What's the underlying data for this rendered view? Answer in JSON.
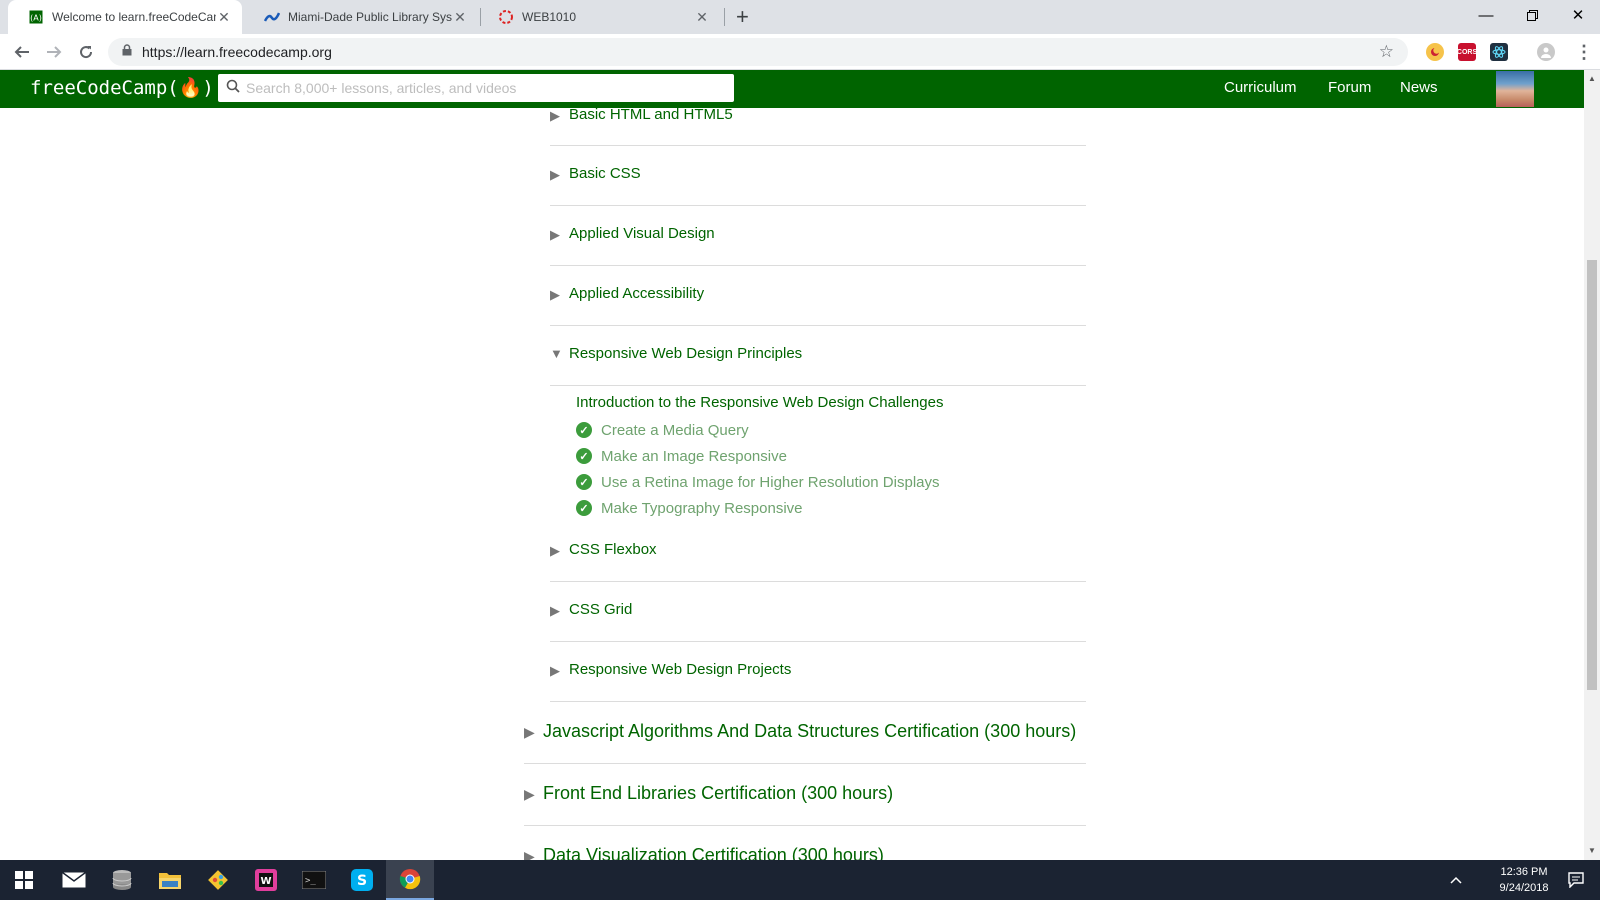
{
  "browser": {
    "tabs": [
      {
        "title": "Welcome to learn.freeCodeCamp"
      },
      {
        "title": "Miami-Dade Public Library Syste"
      },
      {
        "title": "WEB1010"
      }
    ],
    "new_tab_label": "+",
    "url": "https://learn.freecodecamp.org",
    "extensions": [
      "night-icon",
      "cors-icon",
      "react-devtools-icon"
    ]
  },
  "fcc": {
    "logo": "freeCodeCamp(🔥)",
    "search_placeholder": "Search 8,000+ lessons, articles, and videos",
    "nav_links": [
      "Curriculum",
      "Forum",
      "News"
    ]
  },
  "curriculum": {
    "superblocks_top": [
      {
        "title": "Basic HTML and HTML5"
      },
      {
        "title": "Basic CSS"
      },
      {
        "title": "Applied Visual Design"
      },
      {
        "title": "Applied Accessibility"
      },
      {
        "title": "Responsive Web Design Principles"
      }
    ],
    "open_block": {
      "intro": "Introduction to the Responsive Web Design Challenges",
      "challenges": [
        "Create a Media Query",
        "Make an Image Responsive",
        "Use a Retina Image for Higher Resolution Displays",
        "Make Typography Responsive"
      ]
    },
    "superblocks_bottom": [
      {
        "title": "CSS Flexbox"
      },
      {
        "title": "CSS Grid"
      },
      {
        "title": "Responsive Web Design Projects"
      }
    ],
    "certifications": [
      "Javascript Algorithms And Data Structures Certification (300 hours)",
      "Front End Libraries Certification (300 hours)",
      "Data Visualization Certification (300 hours)"
    ]
  },
  "taskbar": {
    "time": "12:36 PM",
    "date": "9/24/2018"
  },
  "colors": {
    "brand": "#006400",
    "completed": "#3c9c3c"
  }
}
